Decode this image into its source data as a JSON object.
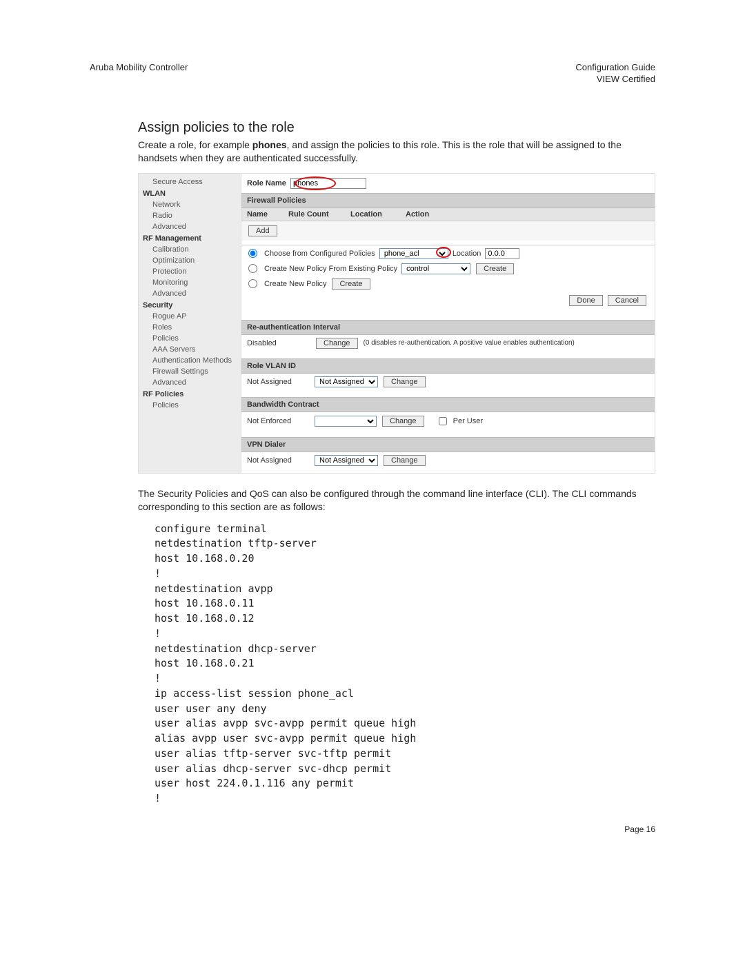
{
  "header": {
    "left": "Aruba Mobility Controller",
    "right1": "Configuration Guide",
    "right2": "VIEW Certified"
  },
  "section": {
    "title": "Assign policies to the role",
    "intro_pre": "Create a role, for example ",
    "intro_bold": "phones",
    "intro_post": ", and assign the policies to this role. This is the role that will be assigned to the handsets when they are authenticated successfully."
  },
  "sidebar": {
    "items": [
      {
        "type": "sub",
        "label": "Secure Access"
      },
      {
        "type": "head",
        "label": "WLAN"
      },
      {
        "type": "sub",
        "label": "Network"
      },
      {
        "type": "sub",
        "label": "Radio"
      },
      {
        "type": "sub",
        "label": "Advanced"
      },
      {
        "type": "head",
        "label": "RF Management"
      },
      {
        "type": "sub",
        "label": "Calibration"
      },
      {
        "type": "sub",
        "label": "Optimization"
      },
      {
        "type": "sub",
        "label": "Protection"
      },
      {
        "type": "sub",
        "label": "Monitoring"
      },
      {
        "type": "sub",
        "label": "Advanced"
      },
      {
        "type": "head",
        "label": "Security"
      },
      {
        "type": "sub",
        "label": "Rogue AP"
      },
      {
        "type": "sub",
        "label": "Roles"
      },
      {
        "type": "sub",
        "label": "Policies"
      },
      {
        "type": "sub",
        "label": "AAA Servers"
      },
      {
        "type": "sub",
        "label": "Authentication Methods"
      },
      {
        "type": "sub",
        "label": "Firewall Settings"
      },
      {
        "type": "sub",
        "label": "Advanced"
      },
      {
        "type": "head",
        "label": "RF Policies"
      },
      {
        "type": "sub",
        "label": "Policies"
      }
    ]
  },
  "role": {
    "name_label": "Role Name",
    "name_value": "phones"
  },
  "firewall": {
    "header": "Firewall Policies",
    "cols": {
      "name": "Name",
      "rule": "Rule Count",
      "loc": "Location",
      "act": "Action"
    },
    "add_btn": "Add",
    "opt1": {
      "label": "Choose from Configured Policies",
      "value": "phone_acl",
      "loc_label": "Location",
      "loc_value": "0.0.0"
    },
    "opt2": {
      "label": "Create New Policy From Existing Policy",
      "value": "control",
      "btn": "Create"
    },
    "opt3": {
      "label": "Create New Policy",
      "btn": "Create"
    },
    "done": "Done",
    "cancel": "Cancel"
  },
  "reauth": {
    "header": "Re-authentication Interval",
    "status": "Disabled",
    "btn": "Change",
    "note": "(0 disables re-authentication. A positive value enables authentication)"
  },
  "vlan": {
    "header": "Role VLAN ID",
    "status": "Not Assigned",
    "select": "Not Assigned",
    "btn": "Change"
  },
  "bw": {
    "header": "Bandwidth Contract",
    "status": "Not Enforced",
    "btn": "Change",
    "peruser": "Per User"
  },
  "vpn": {
    "header": "VPN Dialer",
    "status": "Not Assigned",
    "select": "Not Assigned",
    "btn": "Change"
  },
  "after_text": "The Security Policies and QoS can also be configured through the command line interface (CLI). The CLI commands corresponding to this section are as follows:",
  "cli": "configure terminal\nnetdestination tftp-server\nhost 10.168.0.20\n!\nnetdestination avpp\nhost 10.168.0.11\nhost 10.168.0.12\n!\nnetdestination dhcp-server\nhost 10.168.0.21\n!\nip access-list session phone_acl\nuser user any deny\nuser alias avpp svc-avpp permit queue high\nalias avpp user svc-avpp permit queue high\nuser alias tftp-server svc-tftp permit\nuser alias dhcp-server svc-dhcp permit\nuser host 224.0.1.116 any permit\n!",
  "page_no": "Page 16"
}
